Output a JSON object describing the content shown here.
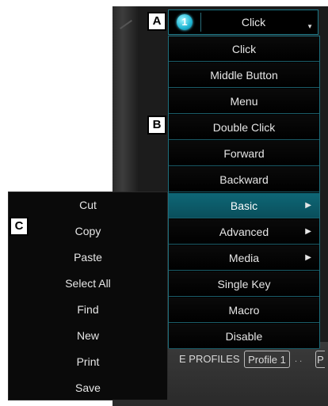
{
  "badges": {
    "a": "A",
    "b": "B",
    "c": "C"
  },
  "selector": {
    "profile_number": "1",
    "value": "Click"
  },
  "menu": {
    "items": [
      {
        "label": "Click",
        "submenu": false
      },
      {
        "label": "Middle Button",
        "submenu": false
      },
      {
        "label": "Menu",
        "submenu": false
      },
      {
        "label": "Double Click",
        "submenu": false
      },
      {
        "label": "Forward",
        "submenu": false
      },
      {
        "label": "Backward",
        "submenu": false
      },
      {
        "label": "Basic",
        "submenu": true,
        "active": true
      },
      {
        "label": "Advanced",
        "submenu": true
      },
      {
        "label": "Media",
        "submenu": true
      },
      {
        "label": "Single Key",
        "submenu": false
      },
      {
        "label": "Macro",
        "submenu": false
      },
      {
        "label": "Disable",
        "submenu": false
      }
    ]
  },
  "submenu": {
    "items": [
      "Cut",
      "Copy",
      "Paste",
      "Select All",
      "Find",
      "New",
      "Print",
      "Save"
    ]
  },
  "tabs": {
    "profiles": "E PROFILES",
    "profile1": "Profile 1",
    "next": "P"
  },
  "colors": {
    "accent": "#0e6776",
    "border": "#1d6e7c",
    "menu_bg": "#000000"
  }
}
